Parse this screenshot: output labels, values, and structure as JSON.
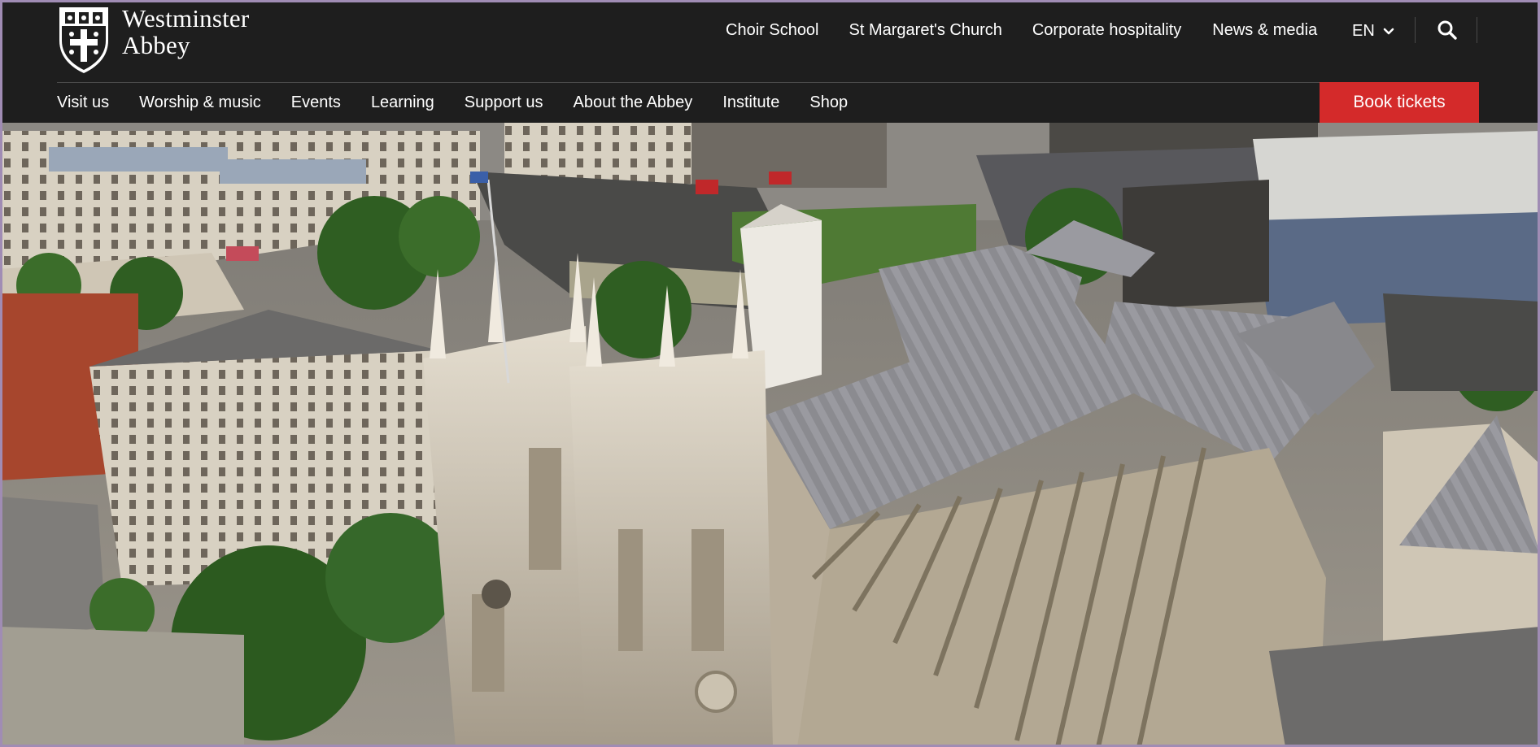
{
  "logo": {
    "line1": "Westminster",
    "line2": "Abbey"
  },
  "top_nav": [
    {
      "label": "Choir School"
    },
    {
      "label": "St Margaret's Church"
    },
    {
      "label": "Corporate hospitality"
    },
    {
      "label": "News & media"
    }
  ],
  "language": {
    "selected": "EN",
    "icon": "chevron-down-icon"
  },
  "search": {
    "icon": "search-icon"
  },
  "main_nav": [
    {
      "label": "Visit us"
    },
    {
      "label": "Worship & music"
    },
    {
      "label": "Events"
    },
    {
      "label": "Learning"
    },
    {
      "label": "Support us"
    },
    {
      "label": "About the Abbey"
    },
    {
      "label": "Institute"
    },
    {
      "label": "Shop"
    }
  ],
  "cta": {
    "label": "Book tickets"
  },
  "colors": {
    "header_bg": "#1e1e1e",
    "accent": "#d42a2a",
    "text": "#ffffff"
  }
}
